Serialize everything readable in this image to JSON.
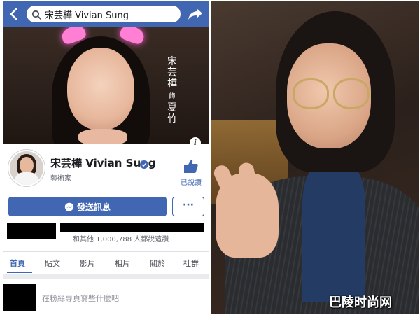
{
  "header": {
    "search_text": "宋芸樺 Vivian Sung"
  },
  "cover": {
    "caption_name": "宋芸樺",
    "caption_role_marker": "飾",
    "caption_character": "夏竹"
  },
  "profile": {
    "name": "宋芸樺 Vivian Sung",
    "category": "藝術家",
    "like_label": "已說讚"
  },
  "actions": {
    "message_label": "發送訊息",
    "more_label": "···"
  },
  "likes_summary": "和其他 1,000,788 人都說這讚",
  "tabs": [
    {
      "label": "首頁",
      "active": true
    },
    {
      "label": "貼文",
      "active": false
    },
    {
      "label": "影片",
      "active": false
    },
    {
      "label": "相片",
      "active": false
    },
    {
      "label": "關於",
      "active": false
    },
    {
      "label": "社群",
      "active": false
    }
  ],
  "composer": {
    "placeholder": "在粉絲專頁寫些什麼吧"
  },
  "watermark": "巴陵时尚网",
  "colors": {
    "facebook_blue": "#4267b2"
  },
  "icons": [
    "back-icon",
    "search-icon",
    "share-icon",
    "info-icon",
    "verified-icon",
    "like-icon",
    "messenger-icon"
  ]
}
